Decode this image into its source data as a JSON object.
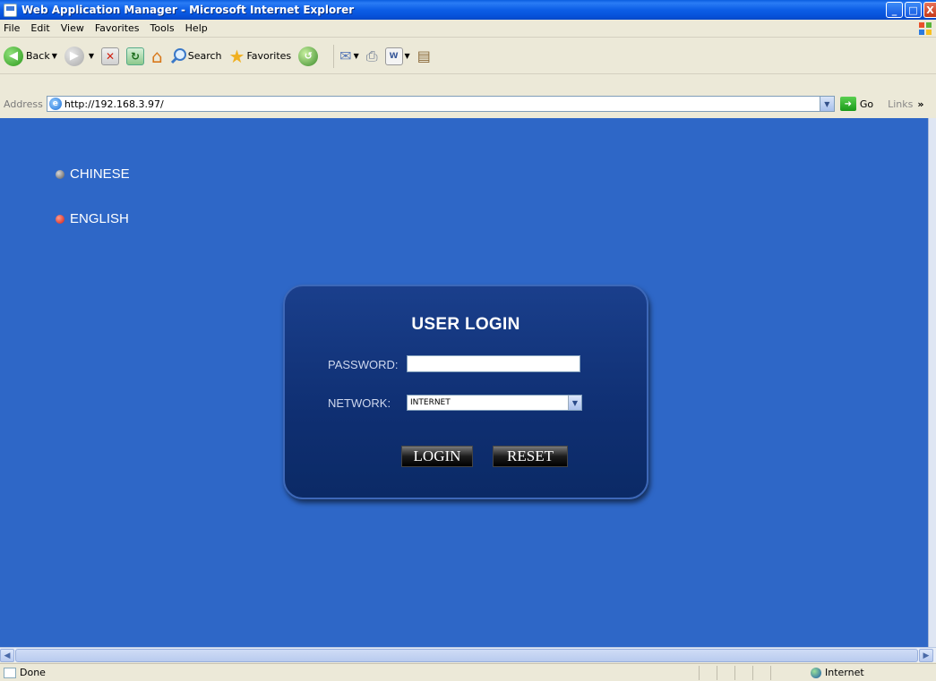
{
  "window": {
    "title": "Web Application Manager - Microsoft Internet Explorer",
    "controls": {
      "minimize": "_",
      "maximize": "□",
      "close": "X"
    }
  },
  "menubar": {
    "items": [
      "File",
      "Edit",
      "View",
      "Favorites",
      "Tools",
      "Help"
    ]
  },
  "toolbar": {
    "back_label": "Back",
    "search_label": "Search",
    "favorites_label": "Favorites"
  },
  "address": {
    "label": "Address",
    "url": "http://192.168.3.97/",
    "go_label": "Go",
    "links_label": "Links"
  },
  "page": {
    "languages": [
      {
        "label": "CHINESE",
        "selected": false
      },
      {
        "label": "ENGLISH",
        "selected": true
      }
    ],
    "login": {
      "title": "USER LOGIN",
      "password_label": "PASSWORD:",
      "password_value": "",
      "network_label": "NETWORK:",
      "network_value": "INTERNET",
      "login_button": "LOGIN",
      "reset_button": "RESET"
    },
    "colors": {
      "background": "#2e67c7",
      "panel": "#0f2f72",
      "accent_red": "#d01a10"
    }
  },
  "status": {
    "text": "Done",
    "zone": "Internet"
  }
}
